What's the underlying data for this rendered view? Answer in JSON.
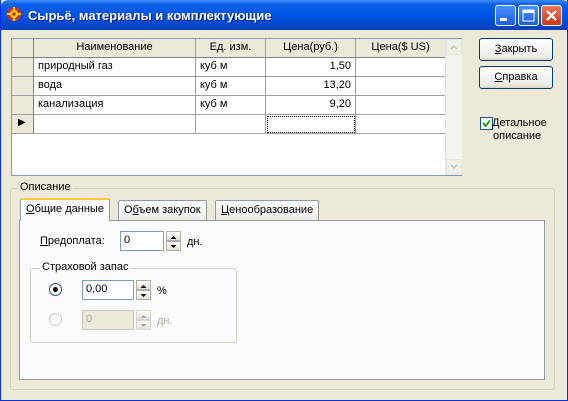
{
  "window": {
    "title": "Сырьё, материалы и комплектующие",
    "accent": "#0054e3"
  },
  "grid": {
    "columns": [
      "Наименование",
      "Ед. изм.",
      "Цена(руб.)",
      "Цена($ US)"
    ],
    "rows": [
      {
        "name": "природный газ",
        "unit": "куб м",
        "price_rub": "1,50",
        "price_usd": ""
      },
      {
        "name": "вода",
        "unit": "куб м",
        "price_rub": "13,20",
        "price_usd": ""
      },
      {
        "name": "канализация",
        "unit": "куб м",
        "price_rub": "9,20",
        "price_usd": ""
      }
    ],
    "new_row_indicator": "▶"
  },
  "buttons": {
    "close": "Закрыть",
    "close_mnemonic": "З",
    "close_rest": "акрыть",
    "help_mnemonic": "С",
    "help_rest": "правка"
  },
  "detail_checkbox": {
    "label_line1": "Детальное",
    "label_line2": "описание",
    "checked": true
  },
  "description": {
    "legend": "Описание",
    "tabs": [
      {
        "mnemonic": "О",
        "rest": "бщие данные",
        "active": true
      },
      {
        "pre": "О",
        "mnemonic": "б",
        "rest": "ъем закупок",
        "active": false
      },
      {
        "mnemonic": "Ц",
        "rest": "енообразование",
        "active": false
      }
    ],
    "prepay_mnemonic": "П",
    "prepay_rest": "редоплата:",
    "prepay_value": "0",
    "prepay_unit": "дн.",
    "reserve": {
      "legend": "Страховой запас",
      "percent_value": "0,00",
      "percent_unit": "%",
      "days_value": "0",
      "days_unit": "дн.",
      "selected": "percent"
    }
  }
}
